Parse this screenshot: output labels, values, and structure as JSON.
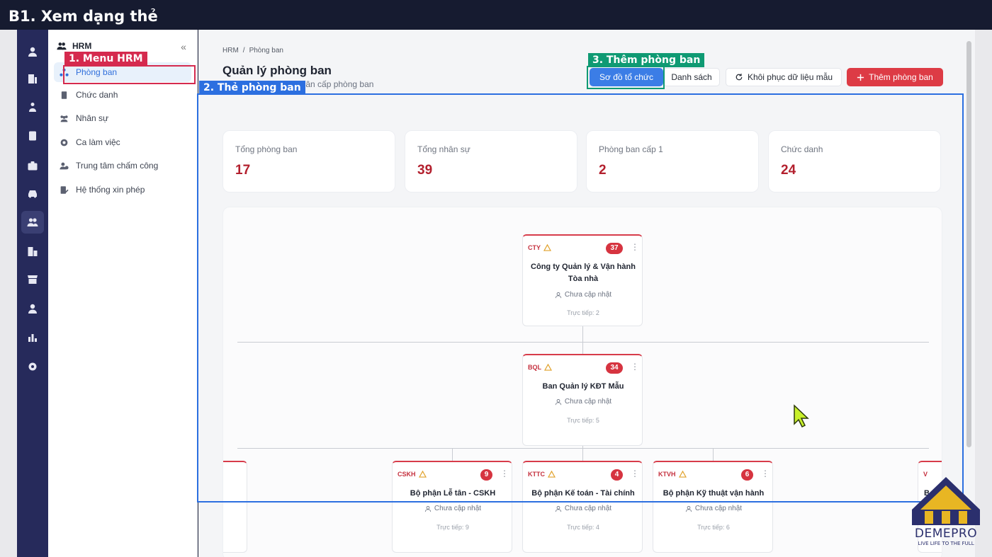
{
  "video_title": "B1. Xem dạng thẻ",
  "annotations": {
    "menu": "1. Menu HRM",
    "cards": "2. Thẻ phòng ban",
    "add": "3. Thêm phòng ban"
  },
  "sidebar": {
    "section": "HRM",
    "collapse": "«",
    "items": [
      {
        "label": "Phòng ban",
        "icon": "org-icon",
        "active": true
      },
      {
        "label": "Chức danh",
        "icon": "badge-icon"
      },
      {
        "label": "Nhân sự",
        "icon": "users-icon"
      },
      {
        "label": "Ca làm việc",
        "icon": "clock-icon"
      },
      {
        "label": "Trung tâm chấm công",
        "icon": "user-clock-icon"
      },
      {
        "label": "Hệ thống xin phép",
        "icon": "leave-request-icon"
      }
    ]
  },
  "header": {
    "breadcrumb_root": "HRM",
    "breadcrumb_sep": "/",
    "breadcrumb_current": "Phòng ban",
    "title": "Quản lý phòng ban",
    "subtitle": "phân cấp phòng ban"
  },
  "toolbar": {
    "org_chart": "Sơ đồ tổ chức",
    "list": "Danh sách",
    "restore": "Khôi phục dữ liệu mẫu",
    "add": "Thêm phòng ban"
  },
  "stats": [
    {
      "label": "Tổng phòng ban",
      "value": "17"
    },
    {
      "label": "Tổng nhân sự",
      "value": "39"
    },
    {
      "label": "Phòng ban cấp 1",
      "value": "2"
    },
    {
      "label": "Chức danh",
      "value": "24"
    }
  ],
  "org": {
    "root": {
      "code": "CTY",
      "count": "37",
      "name": "Công ty Quản lý & Vận hành Tòa nhà",
      "manager": "Chưa cập nhật",
      "direct": "Trực tiếp: 2"
    },
    "level1": {
      "code": "BQL",
      "count": "34",
      "name": "Ban Quản lý KĐT Mẫu",
      "manager": "Chưa cập nhật",
      "direct": "Trực tiếp: 5"
    },
    "level2": [
      {
        "code": "CSKH",
        "count": "9",
        "name": "Bộ phận Lễ tân - CSKH",
        "manager": "Chưa cập nhật",
        "direct": "Trực tiếp: 9"
      },
      {
        "code": "KTTC",
        "count": "4",
        "name": "Bộ phận Kế toán - Tài chính",
        "manager": "Chưa cập nhật",
        "direct": "Trực tiếp: 4"
      },
      {
        "code": "KTVH",
        "count": "6",
        "name": "Bộ phận Kỹ thuật vận hành",
        "manager": "Chưa cập nhật",
        "direct": "Trực tiếp: 6"
      }
    ],
    "partial_right_code": "V",
    "partial_right_name": "B"
  },
  "logo": {
    "name": "DEMEPRO",
    "tagline": "LIVE LIFE TO THE FULL"
  }
}
